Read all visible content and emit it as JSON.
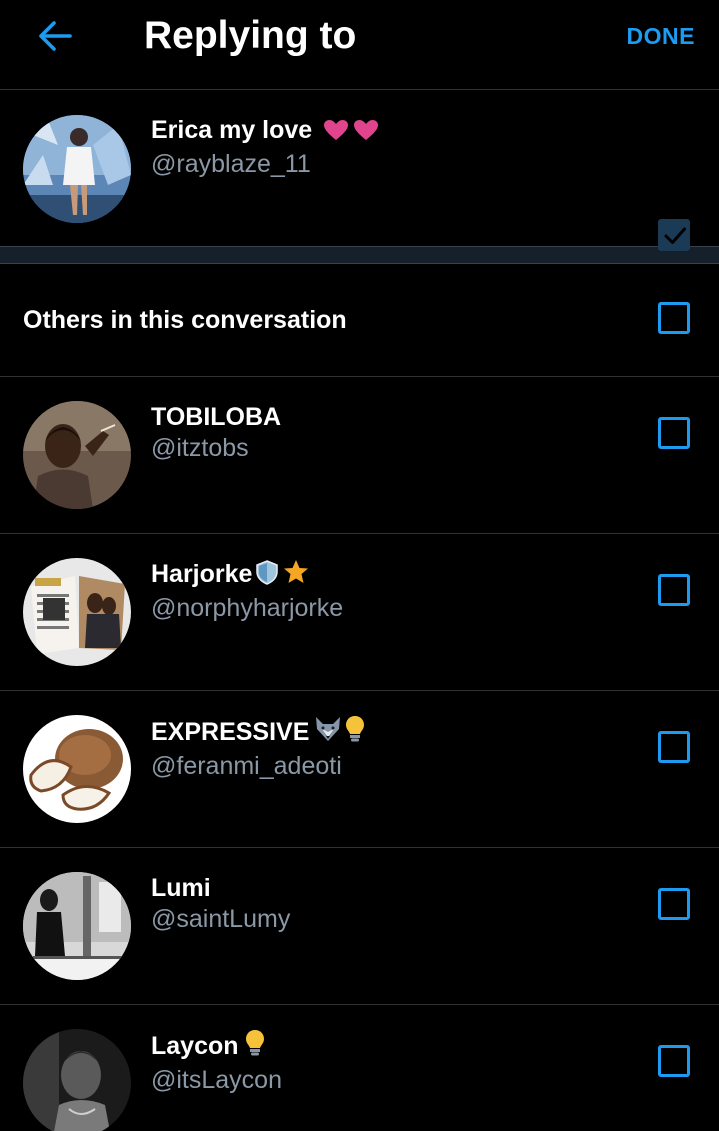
{
  "header": {
    "title": "Replying to",
    "done_label": "DONE",
    "back_icon": "arrow-left-icon"
  },
  "colors": {
    "accent": "#1d9bf0",
    "background": "#000000",
    "secondary_text": "#8b98a5",
    "separator": "#2f3336"
  },
  "primary_user": {
    "display_name": "Erica my love",
    "emoji": [
      "heart-icon",
      "heart-icon"
    ],
    "handle": "@rayblaze_11",
    "checked": true
  },
  "others_section": {
    "label": "Others in this conversation",
    "checked": false
  },
  "others": [
    {
      "display_name": "TOBILOBA",
      "emoji": [],
      "handle": "@itztobs",
      "checked": false
    },
    {
      "display_name": "Harjorke",
      "emoji": [
        "shield-icon",
        "star-icon"
      ],
      "handle": "@norphyharjorke",
      "checked": false
    },
    {
      "display_name": "EXPRESSIVE",
      "emoji": [
        "wolf-icon",
        "lightbulb-icon"
      ],
      "handle": "@feranmi_adeoti",
      "checked": false
    },
    {
      "display_name": "Lumi",
      "emoji": [],
      "handle": "@saintLumy",
      "checked": false
    },
    {
      "display_name": "Laycon",
      "emoji": [
        "lightbulb-icon"
      ],
      "handle": "@itsLaycon",
      "checked": false
    }
  ]
}
